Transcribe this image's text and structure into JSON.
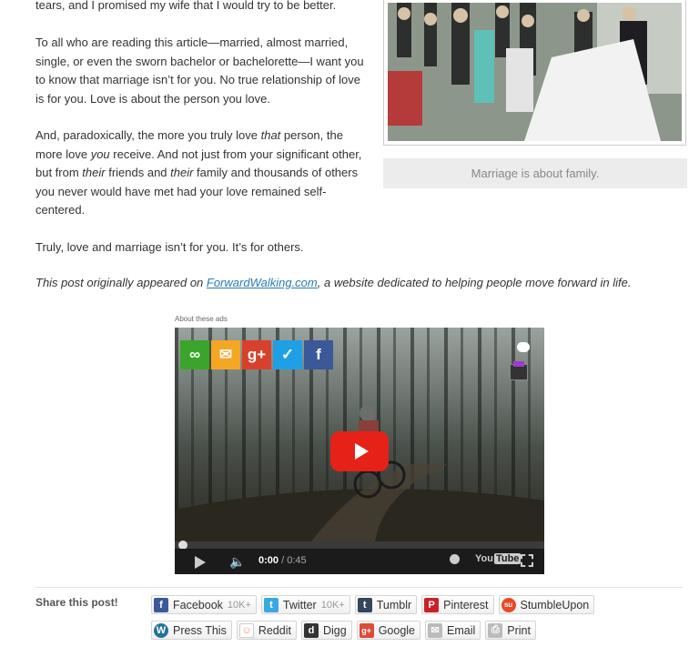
{
  "article": {
    "p1": "tears, and I promised my wife that I would try to be better.",
    "p2": "To all who are reading this article—married, almost married, single, or even the sworn bachelor or bachelorette—I want you to know that marriage isn’t for you. No true relationship of love is for you. Love is about the person you love.",
    "p3_a": "And, paradoxically, the more you truly love ",
    "p3_b": "that",
    "p3_c": " person, the more love ",
    "p3_d": "you",
    "p3_e": " receive. And not just from your significant other, but from ",
    "p3_f": "their",
    "p3_g": " friends and ",
    "p3_h": "their",
    "p3_i": " family and thousands of others you never would have met had your love remained self-centered.",
    "p4": "Truly, love and marriage isn’t for you. It’s for others.",
    "source_prefix": "This post originally appeared on ",
    "source_link": "ForwardWalking.com",
    "source_suffix": ", a website dedicated to helping people move forward in life."
  },
  "photo": {
    "caption": "Marriage is about family."
  },
  "ads": {
    "label": "About these ads"
  },
  "video": {
    "time_current": "0:00",
    "time_separator": " / ",
    "time_total": "0:45",
    "youtube_you": "You",
    "youtube_tube": "Tube",
    "progress": 0,
    "share_icons": [
      {
        "name": "link-icon",
        "glyph": "∞",
        "color": "#3aa52b"
      },
      {
        "name": "email-icon",
        "glyph": "✉",
        "color": "#f5a623"
      },
      {
        "name": "google-plus-icon",
        "glyph": "g+",
        "color": "#d7412c"
      },
      {
        "name": "twitter-icon",
        "glyph": "✓",
        "color": "#1fa0e6"
      },
      {
        "name": "facebook-icon",
        "glyph": "f",
        "color": "#3b5998"
      }
    ]
  },
  "share": {
    "title": "Share this post!",
    "row1": [
      {
        "label": "Facebook",
        "count": "10K+",
        "icon": "facebook-icon",
        "glyph": "f",
        "color": "#3b5998"
      },
      {
        "label": "Twitter",
        "count": "10K+",
        "icon": "twitter-icon",
        "glyph": "t",
        "color": "#39a9e0"
      },
      {
        "label": "Tumblr",
        "count": "",
        "icon": "tumblr-icon",
        "glyph": "t",
        "color": "#35465c"
      },
      {
        "label": "Pinterest",
        "count": "",
        "icon": "pinterest-icon",
        "glyph": "P",
        "color": "#cb2027"
      },
      {
        "label": "StumbleUpon",
        "count": "",
        "icon": "stumbleupon-icon",
        "glyph": "su",
        "color": "#eb4924"
      }
    ],
    "row2": [
      {
        "label": "Press This",
        "icon": "wordpress-icon",
        "glyph": "W",
        "color": "#21759b"
      },
      {
        "label": "Reddit",
        "icon": "reddit-icon",
        "glyph": "☺",
        "color": "#ff8b60"
      },
      {
        "label": "Digg",
        "icon": "digg-icon",
        "glyph": "d",
        "color": "#333333"
      },
      {
        "label": "Google",
        "icon": "google-icon",
        "glyph": "g+",
        "color": "#dd4b39"
      },
      {
        "label": "Email",
        "icon": "email-icon",
        "glyph": "✉",
        "color": "#999999"
      },
      {
        "label": "Print",
        "icon": "print-icon",
        "glyph": "⎙",
        "color": "#999999"
      }
    ]
  }
}
